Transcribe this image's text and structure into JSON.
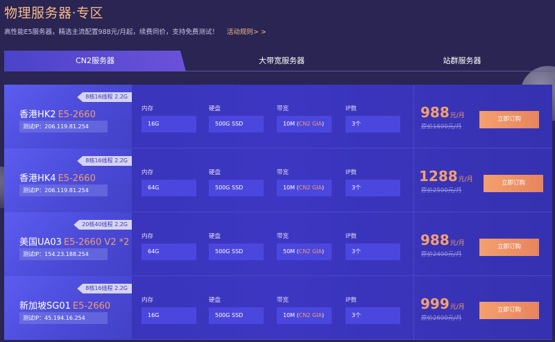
{
  "header": {
    "title": "物理服务器·专区",
    "subtitle": "高性能E5服务器，精选主流配置988元/月起，续费同价，支持免费测试！",
    "rules_link": "活动规则> >"
  },
  "tabs": [
    {
      "label": "CN2服务器",
      "active": true
    },
    {
      "label": "大带宽服务器",
      "active": false
    },
    {
      "label": "站群服务器",
      "active": false
    }
  ],
  "spec_labels": {
    "memory": "内存",
    "disk": "硬盘",
    "bandwidth": "带宽",
    "ip": "IP数"
  },
  "buy_label": "立即订购",
  "colors": {
    "accent": "#f39c6b",
    "background": "#2a2552",
    "card": "#3834b5"
  },
  "servers": [
    {
      "badge": "8核16线程 2.2G",
      "name": "香港HK2",
      "cpu": "E5-2660",
      "test_ip": "测试IP：206.119.81.254",
      "memory": "16G",
      "disk": "500G SSD",
      "bw_main": "10M (",
      "bw_hl": "CN2 GIA",
      "bw_end": ")",
      "ip": "3个",
      "price": "988",
      "price_unit": "元/月",
      "orig_price": "原价1600元/月"
    },
    {
      "badge": "8核16线程 2.2G",
      "name": "香港HK4",
      "cpu": "E5-2660",
      "test_ip": "测试IP：206.119.81.254",
      "memory": "64G",
      "disk": "500G SSD",
      "bw_main": "10M (",
      "bw_hl": "CN2 GIA",
      "bw_end": ")",
      "ip": "3个",
      "price": "1288",
      "price_unit": "元/月",
      "orig_price": "原价2500元/月"
    },
    {
      "badge": "20核40线程 2.2G",
      "name": "美国UA03",
      "cpu": "E5-2660 V2 *2",
      "test_ip": "测试IP：154.23.188.254",
      "memory": "64G",
      "disk": "500G SSD",
      "bw_main": "50M (",
      "bw_hl": "CN2 GIA",
      "bw_end": ")",
      "ip": "3个",
      "price": "988",
      "price_unit": "元/月",
      "orig_price": "原价2400元/月"
    },
    {
      "badge": "8核16线程 2.2G",
      "name": "新加坡SG01",
      "cpu": "E5-2660",
      "test_ip": "测试IP：45.194.16.254",
      "memory": "16G",
      "disk": "500G SSD",
      "bw_main": "10M (",
      "bw_hl": "CN2 GIA",
      "bw_end": ")",
      "ip": "3个",
      "price": "999",
      "price_unit": "元/月",
      "orig_price": "原价2600元/月"
    }
  ]
}
